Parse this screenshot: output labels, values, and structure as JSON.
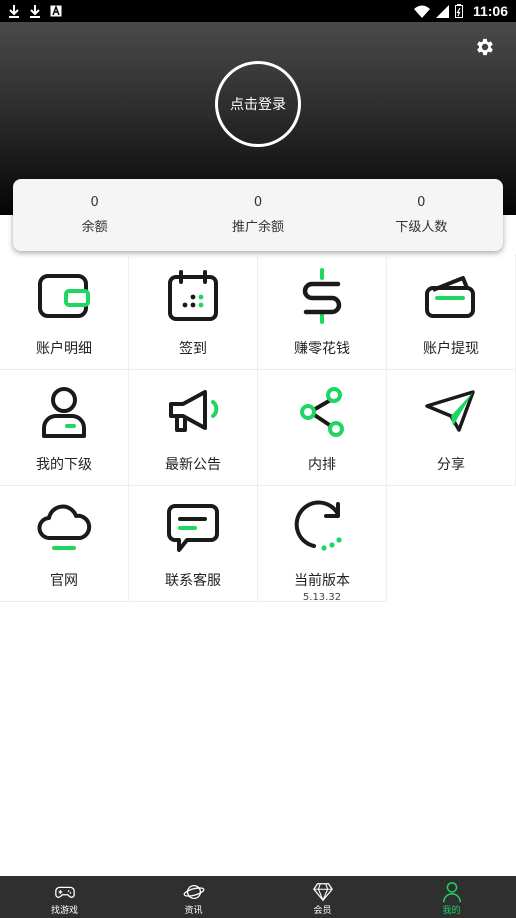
{
  "status_bar": {
    "time": "11:06",
    "left_icons": [
      "download-icon",
      "download-icon",
      "notification-a-icon"
    ],
    "right_icons": [
      "wifi-icon",
      "signal-icon",
      "battery-icon"
    ]
  },
  "header": {
    "login_label": "点击登录",
    "settings_icon": "gear-icon"
  },
  "stats": [
    {
      "value": "0",
      "label": "余额"
    },
    {
      "value": "0",
      "label": "推广余额"
    },
    {
      "value": "0",
      "label": "下级人数"
    }
  ],
  "grid": [
    {
      "label": "账户明细",
      "icon": "wallet-icon"
    },
    {
      "label": "签到",
      "icon": "calendar-icon"
    },
    {
      "label": "赚零花钱",
      "icon": "dollar-icon"
    },
    {
      "label": "账户提现",
      "icon": "card-icon"
    },
    {
      "label": "我的下级",
      "icon": "user-icon"
    },
    {
      "label": "最新公告",
      "icon": "megaphone-icon"
    },
    {
      "label": "内排",
      "icon": "share-icon"
    },
    {
      "label": "分享",
      "icon": "paper-plane-icon"
    },
    {
      "label": "官网",
      "icon": "cloud-icon"
    },
    {
      "label": "联系客服",
      "icon": "chat-icon"
    },
    {
      "label": "当前版本",
      "icon": "refresh-icon",
      "sub": "5.13.32"
    }
  ],
  "bottom_nav": [
    {
      "label": "找游戏",
      "icon": "gamepad-icon",
      "active": false
    },
    {
      "label": "资讯",
      "icon": "planet-icon",
      "active": false
    },
    {
      "label": "会员",
      "icon": "diamond-icon",
      "active": false
    },
    {
      "label": "我的",
      "icon": "person-icon",
      "active": true
    }
  ],
  "colors": {
    "accent": "#1ed760",
    "nav_bg": "#2f2f2f",
    "icon_dark": "#1a1a1a"
  }
}
